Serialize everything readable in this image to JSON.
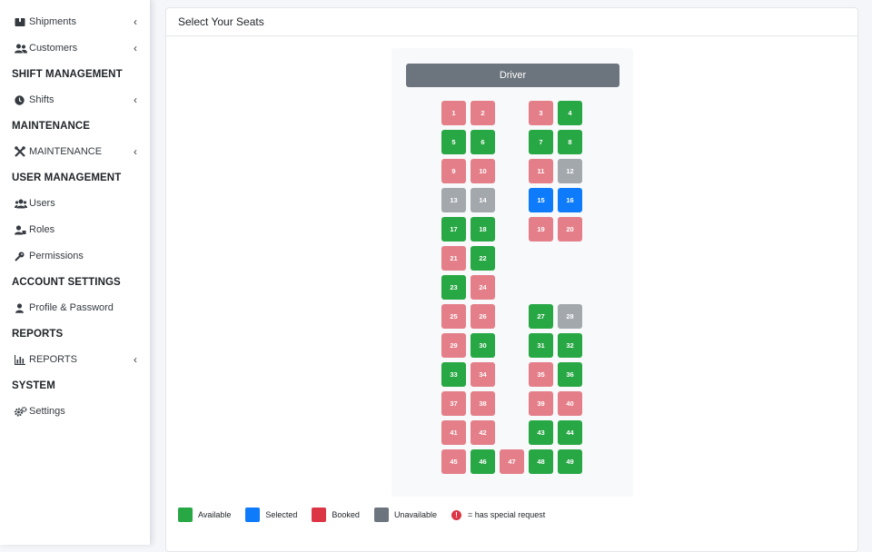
{
  "sidebar": {
    "items": [
      {
        "label": "Shipments",
        "icon": "box-icon",
        "chevron": true
      },
      {
        "label": "Customers",
        "icon": "users-icon",
        "chevron": true
      },
      {
        "label": "Shifts",
        "icon": "clock-icon",
        "chevron": true
      },
      {
        "label": "MAINTENANCE",
        "icon": "tools-icon",
        "chevron": true
      },
      {
        "label": "Users",
        "icon": "users-icon",
        "chevron": false
      },
      {
        "label": "Roles",
        "icon": "user-tag-icon",
        "chevron": false
      },
      {
        "label": "Permissions",
        "icon": "key-icon",
        "chevron": false
      },
      {
        "label": "Profile & Password",
        "icon": "user-icon",
        "chevron": false
      },
      {
        "label": "REPORTS",
        "icon": "chart-bar-icon",
        "chevron": true
      },
      {
        "label": "Settings",
        "icon": "gears-icon",
        "chevron": false
      }
    ],
    "headers": [
      "SHIFT MANAGEMENT",
      "MAINTENANCE",
      "USER MANAGEMENT",
      "ACCOUNT SETTINGS",
      "REPORTS",
      "SYSTEM"
    ]
  },
  "seat_panel": {
    "title": "Select Your Seats",
    "driver_label": "Driver"
  },
  "seats": [
    {
      "n": "1",
      "status": "booked"
    },
    {
      "n": "2",
      "status": "booked"
    },
    {
      "n": "3",
      "status": "booked"
    },
    {
      "n": "4",
      "status": "available"
    },
    {
      "n": "5",
      "status": "available"
    },
    {
      "n": "6",
      "status": "available"
    },
    {
      "n": "7",
      "status": "available"
    },
    {
      "n": "8",
      "status": "available"
    },
    {
      "n": "9",
      "status": "booked"
    },
    {
      "n": "10",
      "status": "booked"
    },
    {
      "n": "11",
      "status": "booked"
    },
    {
      "n": "12",
      "status": "unavailable"
    },
    {
      "n": "13",
      "status": "unavailable"
    },
    {
      "n": "14",
      "status": "unavailable"
    },
    {
      "n": "15",
      "status": "selected"
    },
    {
      "n": "16",
      "status": "selected"
    },
    {
      "n": "17",
      "status": "available"
    },
    {
      "n": "18",
      "status": "available"
    },
    {
      "n": "19",
      "status": "booked"
    },
    {
      "n": "20",
      "status": "booked"
    },
    {
      "n": "21",
      "status": "booked"
    },
    {
      "n": "22",
      "status": "available"
    },
    {
      "n": "23",
      "status": "available"
    },
    {
      "n": "24",
      "status": "booked"
    },
    {
      "n": "25",
      "status": "booked"
    },
    {
      "n": "26",
      "status": "booked"
    },
    {
      "n": "27",
      "status": "available"
    },
    {
      "n": "28",
      "status": "unavailable"
    },
    {
      "n": "29",
      "status": "booked"
    },
    {
      "n": "30",
      "status": "available"
    },
    {
      "n": "31",
      "status": "available"
    },
    {
      "n": "32",
      "status": "available"
    },
    {
      "n": "33",
      "status": "available"
    },
    {
      "n": "34",
      "status": "booked"
    },
    {
      "n": "35",
      "status": "booked"
    },
    {
      "n": "36",
      "status": "available"
    },
    {
      "n": "37",
      "status": "booked"
    },
    {
      "n": "38",
      "status": "booked"
    },
    {
      "n": "39",
      "status": "booked"
    },
    {
      "n": "40",
      "status": "booked"
    },
    {
      "n": "41",
      "status": "booked"
    },
    {
      "n": "42",
      "status": "booked"
    },
    {
      "n": "43",
      "status": "available"
    },
    {
      "n": "44",
      "status": "available"
    },
    {
      "n": "45",
      "status": "booked"
    },
    {
      "n": "46",
      "status": "available"
    },
    {
      "n": "47",
      "status": "booked"
    },
    {
      "n": "48",
      "status": "available"
    },
    {
      "n": "49",
      "status": "available"
    }
  ],
  "legend": {
    "available": "Available",
    "selected": "Selected",
    "booked": "Booked",
    "unavailable": "Unavailable",
    "special": "= has special request",
    "special_mark": "!"
  },
  "colors": {
    "available": "#28a745",
    "selected": "#0d7bfa",
    "booked": "#e47f89",
    "booked_legend": "#dc3545",
    "unavailable": "#a3a8ad",
    "unavailable_legend": "#6c757d",
    "driver": "#6c757d"
  }
}
